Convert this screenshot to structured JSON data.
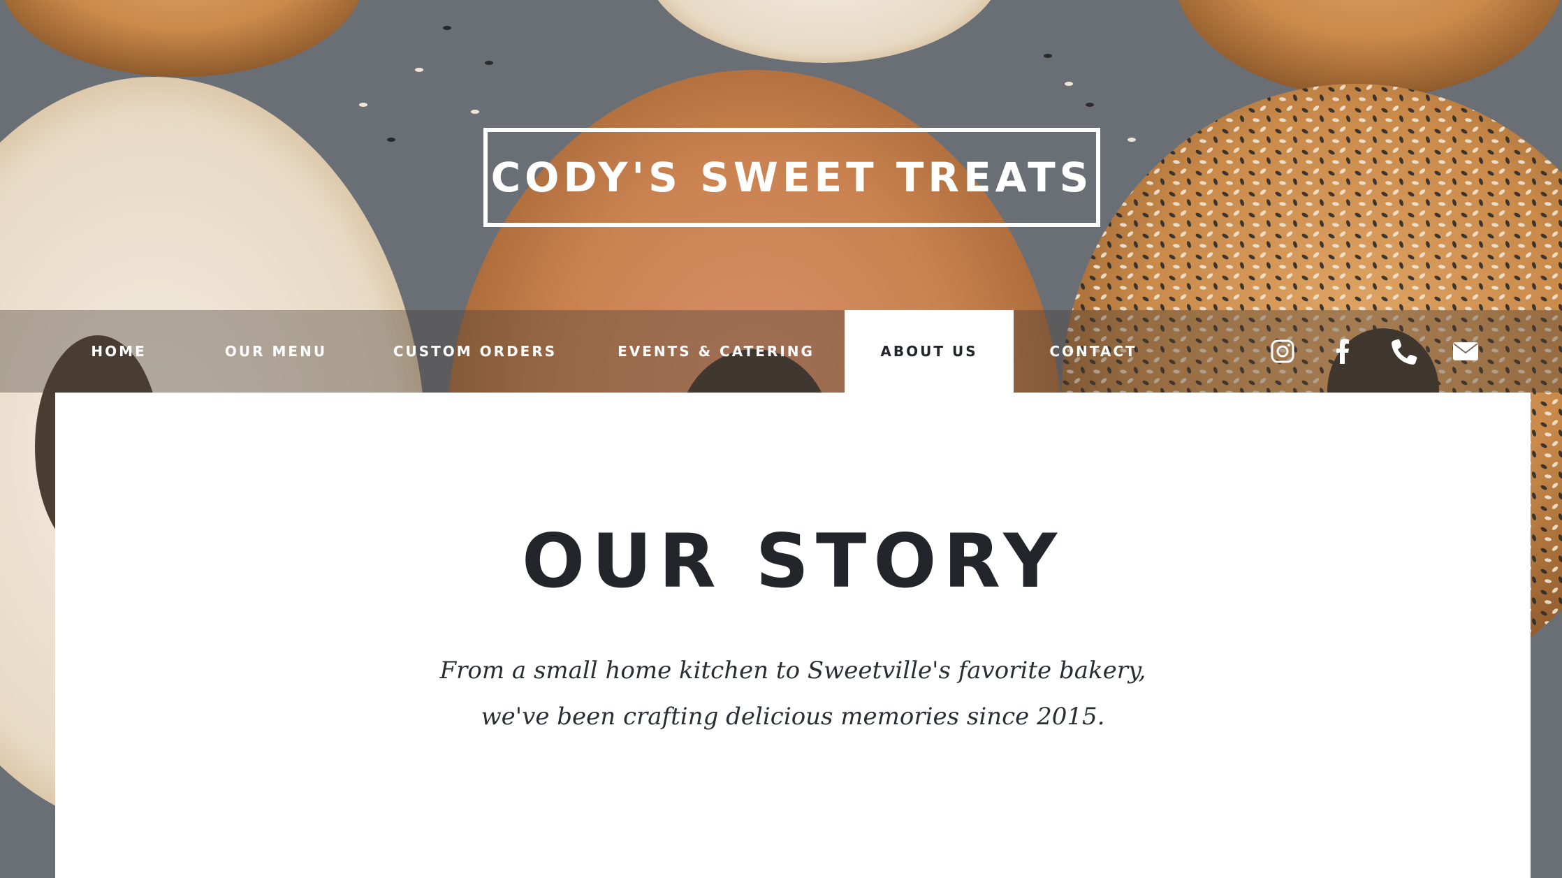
{
  "brand": {
    "title": "CODY'S SWEET TREATS"
  },
  "nav": {
    "items": [
      {
        "label": "HOME"
      },
      {
        "label": "OUR MENU"
      },
      {
        "label": "CUSTOM ORDERS"
      },
      {
        "label": "EVENTS & CATERING"
      },
      {
        "label": "ABOUT US",
        "active": true
      },
      {
        "label": "CONTACT"
      }
    ],
    "social_icons": [
      "instagram-icon",
      "facebook-icon",
      "phone-icon",
      "email-icon"
    ]
  },
  "main": {
    "title": "OUR STORY",
    "subtitle_lines": [
      "From a small home kitchen to Sweetville's favorite bakery,",
      "we've been crafting delicious memories since 2015."
    ]
  },
  "colors": {
    "text_dark": "#22262b",
    "white": "#ffffff",
    "bagel_crust": "#c98a4a",
    "background_gray": "#5e636a"
  }
}
